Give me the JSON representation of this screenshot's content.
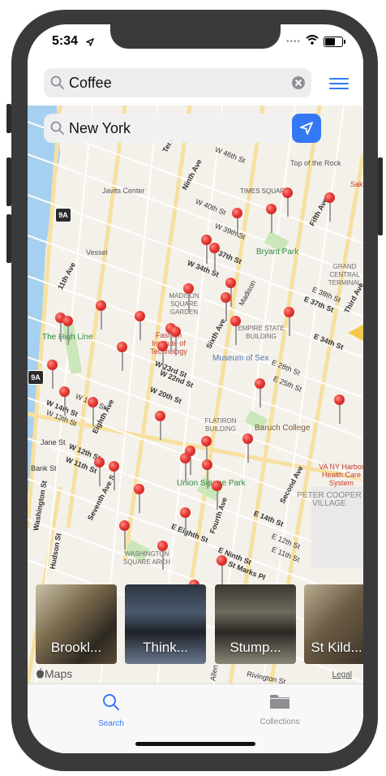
{
  "status": {
    "time": "5:34"
  },
  "top_search": {
    "query": "Coffee"
  },
  "map_search": {
    "query": "New York"
  },
  "map": {
    "labels": {
      "javits": "Javits Center",
      "vessel": "Vessel",
      "times_square": "TIMES SQUARE",
      "top_of_rock": "Top of the Rock",
      "bryant_park": "Bryant Park",
      "grand_central": "GRAND\nCENTRAL\nTERMINAL",
      "msg": "MADISON\nSQUARE\nGARDEN",
      "high_line": "The High Line",
      "fit": "Fashion\nInstitute of\nTechnology",
      "empire": "EMPIRE STATE\nBUILDING",
      "museum_sex": "Museum of Sex",
      "flatiron": "FLATIRON\nBUILDING",
      "baruch": "Baruch College",
      "union_sq": "Union Square Park",
      "va": "VA NY Harbor\nHealth Care\nSystem",
      "peter_cooper": "PETER COOPER\nVILLAGE",
      "washington_sq": "WASHINGTON\nSQUARE ARCH",
      "sak": "Sak"
    },
    "streets": {
      "ninth_ave": "Ninth Ave",
      "eleventh_ave": "11th Ave",
      "tenth_ave": "Tent",
      "sixth_ave": "Sixth Ave",
      "w34": "W 34th St",
      "w37": "W 37th St",
      "w23": "W 23rd St",
      "w22": "W 22nd St",
      "w20": "W 20th St",
      "w14": "W 14th St",
      "w12": "W 12th St",
      "w11": "W 11th St",
      "e37": "E 37th St",
      "e34": "E 34th St",
      "e14": "E 14th St",
      "e9": "E Ninth St",
      "e8": "E Eighth St",
      "jane": "Jane St",
      "bank": "Bank St",
      "hudson": "Hudson St",
      "washington": "Washington St",
      "seventh": "Seventh Ave S",
      "eighth": "Eighth Ave",
      "second": "Second Ave",
      "fourth": "Fourth Ave",
      "madison": "Madison",
      "w46": "W 46th St",
      "w40": "W 40th St",
      "w39": "W 39th St",
      "third_ave": "Third Ave",
      "fifth_ave": "Fifth Ave",
      "e38": "E 38th St",
      "w13": "W 13th St",
      "w16": "W 16th St",
      "e12": "E 12th St",
      "e11": "E 11th St",
      "e25": "E 25th St",
      "e28": "E 28th St",
      "st_marks": "St Marks Pl",
      "rivington": "Rivington St",
      "allen": "Allen"
    },
    "highway_shield": "9A"
  },
  "cards": [
    {
      "title": "Brookl..."
    },
    {
      "title": "Think..."
    },
    {
      "title": "Stump..."
    },
    {
      "title": "St Kild..."
    }
  ],
  "brand": "Maps",
  "legal": "Legal",
  "tabs": [
    {
      "label": "Search",
      "icon": "search-icon",
      "active": true
    },
    {
      "label": "Collections",
      "icon": "folder-icon",
      "active": false
    }
  ],
  "colors": {
    "accent": "#3478f6",
    "pin": "#e53935",
    "park": "#c9e7b8",
    "water": "#a6d0f0"
  }
}
